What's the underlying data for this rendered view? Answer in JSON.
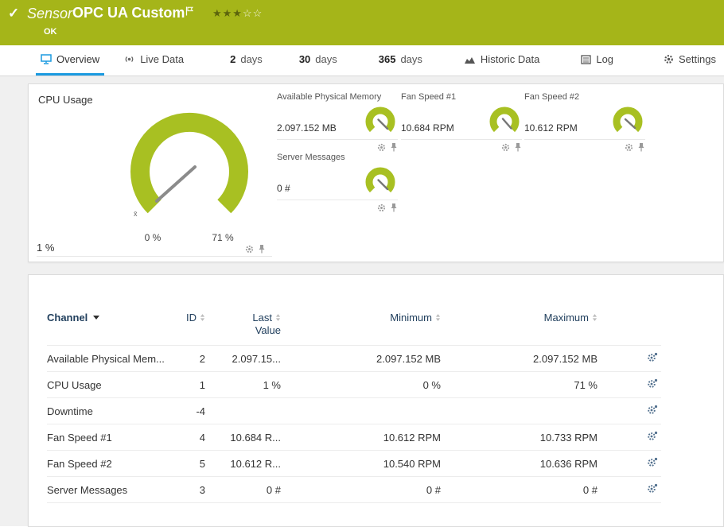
{
  "colors": {
    "header_green": "#a5b519",
    "gauge_green": "#a8c022",
    "active_tab_blue": "#1b9ae0",
    "table_header_navy": "#22405e"
  },
  "header": {
    "check_icon": "✓",
    "kind": "Sensor",
    "title": "OPC UA Custom",
    "status": "OK",
    "rating_filled": "★★★",
    "rating_empty": "☆☆"
  },
  "tabs": [
    {
      "label": "Overview"
    },
    {
      "label": "Live Data"
    },
    {
      "value": "2",
      "unit": "days"
    },
    {
      "value": "30",
      "unit": "days"
    },
    {
      "value": "365",
      "unit": "days"
    },
    {
      "label": "Historic Data"
    },
    {
      "label": "Log"
    },
    {
      "label": "Settings"
    }
  ],
  "gauges": {
    "cpu": {
      "title": "CPU Usage",
      "value": "1 %",
      "min_label": "0 %",
      "max_label": "71 %",
      "avg_marker": "x̄"
    },
    "small": [
      {
        "title": "Available Physical Memory",
        "value": "2.097.152 MB"
      },
      {
        "title": "Fan Speed #1",
        "value": "10.684 RPM"
      },
      {
        "title": "Fan Speed #2",
        "value": "10.612 RPM"
      },
      {
        "title": "Server Messages",
        "value": "0 #"
      }
    ]
  },
  "table": {
    "headers": {
      "channel": "Channel",
      "id": "ID",
      "last_line1": "Last",
      "last_line2": "Value",
      "min": "Minimum",
      "max": "Maximum"
    },
    "rows": [
      {
        "channel": "Available Physical Mem...",
        "id": "2",
        "last": "2.097.15...",
        "min": "2.097.152 MB",
        "max": "2.097.152 MB"
      },
      {
        "channel": "CPU Usage",
        "id": "1",
        "last": "1 %",
        "min": "0 %",
        "max": "71 %"
      },
      {
        "channel": "Downtime",
        "id": "-4",
        "last": "",
        "min": "",
        "max": ""
      },
      {
        "channel": "Fan Speed #1",
        "id": "4",
        "last": "10.684 R...",
        "min": "10.612 RPM",
        "max": "10.733 RPM"
      },
      {
        "channel": "Fan Speed #2",
        "id": "5",
        "last": "10.612 R...",
        "min": "10.540 RPM",
        "max": "10.636 RPM"
      },
      {
        "channel": "Server Messages",
        "id": "3",
        "last": "0 #",
        "min": "0 #",
        "max": "0 #"
      }
    ]
  }
}
